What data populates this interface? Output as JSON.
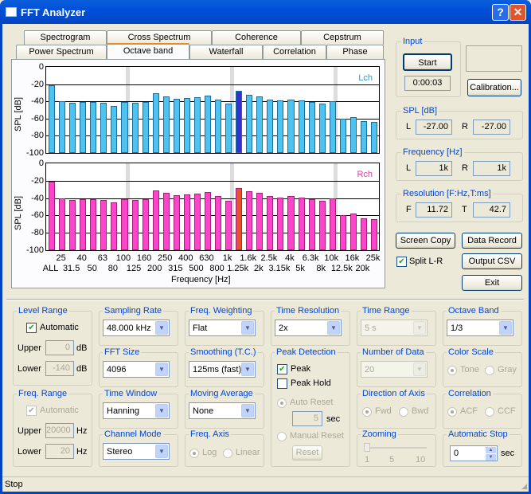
{
  "window": {
    "title": "FFT Analyzer"
  },
  "tabs_row1": [
    "Spectrogram",
    "Cross Spectrum",
    "Coherence",
    "Cepstrum"
  ],
  "tabs_row2": [
    "Power Spectrum",
    "Octave band",
    "Waterfall",
    "Correlation",
    "Phase"
  ],
  "active_tab": "Octave band",
  "chart_data": [
    {
      "type": "bar",
      "title": "",
      "channel_label": "Lch",
      "ylabel": "SPL [dB]",
      "xlabel": "Frequency [Hz]",
      "ylim": [
        -100,
        0
      ],
      "yticks": [
        "0",
        "-20",
        "-40",
        "-60",
        "-80",
        "-100"
      ],
      "categories": [
        "ALL",
        "25",
        "31.5",
        "40",
        "50",
        "63",
        "80",
        "100",
        "125",
        "160",
        "200",
        "250",
        "315",
        "400",
        "500",
        "630",
        "800",
        "1k",
        "1.25k",
        "1.6k",
        "2k",
        "2.5k",
        "3.15k",
        "4k",
        "5k",
        "6.3k",
        "8k",
        "10k",
        "12.5k",
        "16k",
        "20k",
        "25k"
      ],
      "values": [
        -21,
        -40,
        -42,
        -41,
        -41,
        -42,
        -45,
        -41,
        -42,
        -41,
        -31,
        -34,
        -37,
        -36,
        -35,
        -33,
        -38,
        -43,
        -28,
        -32,
        -34,
        -38,
        -39,
        -38,
        -39,
        -41,
        -43,
        -40,
        -60,
        -58,
        -63,
        -64
      ],
      "highlight_index": 18,
      "color": "#4fc3ef",
      "highlight_color": "#3333cc"
    },
    {
      "type": "bar",
      "title": "",
      "channel_label": "Rch",
      "ylabel": "SPL [dB]",
      "xlabel": "Frequency [Hz]",
      "ylim": [
        -100,
        0
      ],
      "yticks": [
        "0",
        "-20",
        "-40",
        "-60",
        "-80",
        "-100"
      ],
      "categories": [
        "ALL",
        "25",
        "31.5",
        "40",
        "50",
        "63",
        "80",
        "100",
        "125",
        "160",
        "200",
        "250",
        "315",
        "400",
        "500",
        "630",
        "800",
        "1k",
        "1.25k",
        "1.6k",
        "2k",
        "2.5k",
        "3.15k",
        "4k",
        "5k",
        "6.3k",
        "8k",
        "10k",
        "12.5k",
        "16k",
        "20k",
        "25k"
      ],
      "values": [
        -21,
        -40,
        -42,
        -41,
        -41,
        -42,
        -45,
        -41,
        -42,
        -41,
        -31,
        -34,
        -37,
        -36,
        -35,
        -33,
        -38,
        -43,
        -28,
        -32,
        -34,
        -38,
        -39,
        -38,
        -39,
        -41,
        -43,
        -40,
        -60,
        -58,
        -63,
        -64
      ],
      "highlight_index": 18,
      "color": "#ff44cc",
      "highlight_color": "#e8532e"
    }
  ],
  "xaxis": {
    "top_labels": [
      "25",
      "40",
      "63",
      "100",
      "160",
      "250",
      "400",
      "630",
      "1k",
      "1.6k",
      "2.5k",
      "4k",
      "6.3k",
      "10k",
      "16k",
      "25k"
    ],
    "bottom_labels": [
      "ALL",
      "31.5",
      "50",
      "80",
      "125",
      "200",
      "315",
      "500",
      "800",
      "1.25k",
      "2k",
      "3.15k",
      "5k",
      "8k",
      "12.5k",
      "20k"
    ]
  },
  "input": {
    "label": "Input",
    "start": "Start",
    "time": "0:00:03",
    "calibration": "Calibration..."
  },
  "spl": {
    "label": "SPL [dB]",
    "l_label": "L",
    "l_value": "-27.00",
    "r_label": "R",
    "r_value": "-27.00"
  },
  "frequency": {
    "label": "Frequency [Hz]",
    "l_label": "L",
    "l_value": "1k",
    "r_label": "R",
    "r_value": "1k"
  },
  "resolution": {
    "label": "Resolution [F:Hz,T:ms]",
    "f_label": "F",
    "f_value": "11.72",
    "t_label": "T",
    "t_value": "42.7"
  },
  "buttons": {
    "screen_copy": "Screen Copy",
    "data_record": "Data Record",
    "output_csv": "Output CSV",
    "exit": "Exit",
    "split": "Split L-R"
  },
  "level_range": {
    "label": "Level Range",
    "automatic": "Automatic",
    "upper_label": "Upper",
    "upper_value": "0",
    "lower_label": "Lower",
    "lower_value": "-140",
    "unit": "dB"
  },
  "freq_range": {
    "label": "Freq. Range",
    "automatic": "Automatic",
    "upper_label": "Upper",
    "upper_value": "20000",
    "lower_label": "Lower",
    "lower_value": "20",
    "unit": "Hz"
  },
  "sampling_rate": {
    "label": "Sampling Rate",
    "value": "48.000 kHz"
  },
  "fft_size": {
    "label": "FFT Size",
    "value": "4096"
  },
  "time_window": {
    "label": "Time Window",
    "value": "Hanning"
  },
  "channel_mode": {
    "label": "Channel Mode",
    "value": "Stereo"
  },
  "freq_weighting": {
    "label": "Freq. Weighting",
    "value": "Flat"
  },
  "smoothing": {
    "label": "Smoothing (T.C.)",
    "value": "125ms (fast)"
  },
  "moving_average": {
    "label": "Moving Average",
    "value": "None"
  },
  "freq_axis": {
    "label": "Freq. Axis",
    "log": "Log",
    "linear": "Linear"
  },
  "time_resolution": {
    "label": "Time Resolution",
    "value": "2x"
  },
  "peak_detection": {
    "label": "Peak Detection",
    "peak": "Peak",
    "peak_hold": "Peak Hold",
    "auto_reset": "Auto Reset",
    "auto_value": "5",
    "sec": "sec",
    "manual_reset": "Manual Reset",
    "reset": "Reset"
  },
  "time_range": {
    "label": "Time Range",
    "value": "5 s"
  },
  "number_of_data": {
    "label": "Number of Data",
    "value": "20"
  },
  "direction_of_axis": {
    "label": "Direction of Axis",
    "fwd": "Fwd",
    "bwd": "Bwd"
  },
  "zooming": {
    "label": "Zooming",
    "ticks": [
      "1",
      "5",
      "10"
    ]
  },
  "octave_band": {
    "label": "Octave Band",
    "value": "1/3"
  },
  "color_scale": {
    "label": "Color Scale",
    "tone": "Tone",
    "gray": "Gray"
  },
  "correlation": {
    "label": "Correlation",
    "acf": "ACF",
    "ccf": "CCF"
  },
  "automatic_stop": {
    "label": "Automatic Stop",
    "value": "0",
    "unit": "sec"
  },
  "status": {
    "text": "Stop"
  }
}
